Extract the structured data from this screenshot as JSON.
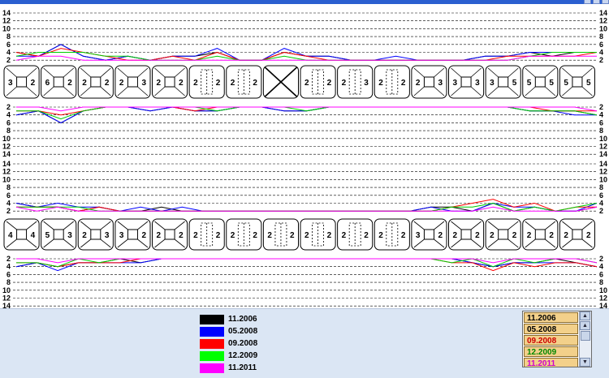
{
  "upper_jaw": {
    "scale_top": [
      "14",
      "12",
      "10",
      "8",
      "6",
      "4",
      "2"
    ],
    "scale_bottom": [
      "2",
      "4",
      "6",
      "8",
      "10",
      "12",
      "14"
    ],
    "teeth": [
      {
        "type": "molar",
        "v": [
          "3",
          "2"
        ]
      },
      {
        "type": "molar",
        "v": [
          "6",
          "2"
        ]
      },
      {
        "type": "molar",
        "v": [
          "2",
          "2"
        ]
      },
      {
        "type": "molar",
        "v": [
          "2",
          "3"
        ]
      },
      {
        "type": "molar",
        "v": [
          "2",
          "2"
        ]
      },
      {
        "type": "premolar",
        "v": [
          "2",
          "2"
        ]
      },
      {
        "type": "premolar",
        "v": [
          "2",
          "2"
        ]
      },
      {
        "type": "missing",
        "v": [
          "",
          ""
        ]
      },
      {
        "type": "premolar",
        "v": [
          "2",
          "2"
        ]
      },
      {
        "type": "premolar",
        "v": [
          "2",
          "3"
        ]
      },
      {
        "type": "premolar",
        "v": [
          "2",
          "2"
        ]
      },
      {
        "type": "molar",
        "v": [
          "2",
          "3"
        ]
      },
      {
        "type": "molar",
        "v": [
          "3",
          "3"
        ]
      },
      {
        "type": "molar",
        "v": [
          "3",
          "5"
        ]
      },
      {
        "type": "molar",
        "v": [
          "5",
          "5"
        ]
      },
      {
        "type": "molar",
        "v": [
          "5",
          "5"
        ]
      }
    ]
  },
  "lower_jaw": {
    "scale_top": [
      "14",
      "12",
      "10",
      "8",
      "6",
      "4",
      "2"
    ],
    "scale_bottom": [
      "2",
      "4",
      "6",
      "8",
      "10",
      "12",
      "14"
    ],
    "teeth": [
      {
        "type": "molar",
        "v": [
          "4",
          "4"
        ]
      },
      {
        "type": "molar",
        "v": [
          "5",
          "3"
        ]
      },
      {
        "type": "molar",
        "v": [
          "2",
          "3"
        ]
      },
      {
        "type": "molar",
        "v": [
          "3",
          "2"
        ]
      },
      {
        "type": "molar",
        "v": [
          "2",
          "2"
        ]
      },
      {
        "type": "premolar",
        "v": [
          "2",
          "2"
        ]
      },
      {
        "type": "premolar",
        "v": [
          "2",
          "2"
        ]
      },
      {
        "type": "premolar",
        "v": [
          "2",
          "2"
        ]
      },
      {
        "type": "premolar",
        "v": [
          "2",
          "2"
        ]
      },
      {
        "type": "premolar",
        "v": [
          "2",
          "2"
        ]
      },
      {
        "type": "premolar",
        "v": [
          "2",
          "2"
        ]
      },
      {
        "type": "molar",
        "v": [
          "3",
          "2"
        ]
      },
      {
        "type": "molar",
        "v": [
          "2",
          "2"
        ]
      },
      {
        "type": "molar",
        "v": [
          "2",
          "2"
        ]
      },
      {
        "type": "molar",
        "v": [
          "2",
          "2"
        ]
      },
      {
        "type": "molar",
        "v": [
          "2",
          "2"
        ]
      }
    ]
  },
  "series_colors": [
    "#000000",
    "#0000ff",
    "#ff0000",
    "#00cc00",
    "#ff00ff"
  ],
  "upper_top_series": [
    [
      4,
      3,
      6,
      3,
      2,
      3,
      2,
      3,
      3,
      4,
      2,
      2,
      4,
      3,
      3,
      2,
      2,
      2,
      2,
      2,
      2,
      3,
      3,
      4,
      3,
      4,
      4
    ],
    [
      3,
      3,
      6,
      3,
      2,
      3,
      2,
      3,
      3,
      5,
      2,
      2,
      5,
      3,
      3,
      2,
      2,
      3,
      2,
      2,
      2,
      3,
      3,
      4,
      4,
      4,
      4
    ],
    [
      4,
      3,
      5,
      4,
      3,
      2,
      2,
      3,
      2,
      4,
      2,
      2,
      4,
      3,
      2,
      2,
      2,
      2,
      2,
      2,
      2,
      2,
      3,
      3,
      3,
      3,
      4
    ],
    [
      3,
      4,
      4,
      4,
      3,
      3,
      2,
      2,
      2,
      3,
      2,
      2,
      3,
      2,
      2,
      2,
      2,
      2,
      2,
      2,
      2,
      2,
      2,
      3,
      4,
      4,
      4
    ],
    [
      2,
      3,
      3,
      2,
      2,
      2,
      2,
      2,
      2,
      2,
      2,
      2,
      2,
      2,
      2,
      2,
      2,
      2,
      2,
      2,
      2,
      2,
      2,
      3,
      3,
      3,
      3
    ]
  ],
  "upper_bottom_series": [
    [
      4,
      3,
      6,
      3,
      2,
      2,
      3,
      2,
      3,
      3,
      2,
      2,
      3,
      3,
      2,
      2,
      2,
      2,
      2,
      2,
      2,
      2,
      2,
      3,
      3,
      3,
      4
    ],
    [
      4,
      3,
      6,
      3,
      2,
      2,
      3,
      2,
      3,
      3,
      2,
      2,
      3,
      3,
      2,
      2,
      2,
      2,
      2,
      2,
      2,
      2,
      2,
      3,
      3,
      4,
      4
    ],
    [
      3,
      3,
      4,
      3,
      2,
      2,
      2,
      2,
      3,
      2,
      2,
      2,
      2,
      2,
      2,
      2,
      2,
      2,
      2,
      2,
      2,
      2,
      2,
      2,
      3,
      3,
      3
    ],
    [
      3,
      3,
      5,
      3,
      2,
      2,
      2,
      2,
      2,
      3,
      2,
      2,
      2,
      3,
      2,
      2,
      2,
      2,
      2,
      2,
      2,
      2,
      2,
      3,
      3,
      3,
      4
    ],
    [
      2,
      2,
      3,
      2,
      2,
      2,
      2,
      2,
      2,
      2,
      2,
      2,
      2,
      2,
      2,
      2,
      2,
      2,
      2,
      2,
      2,
      2,
      2,
      2,
      2,
      2,
      3
    ]
  ],
  "lower_top_series": [
    [
      4,
      3,
      3,
      2,
      3,
      2,
      2,
      3,
      2,
      2,
      2,
      2,
      2,
      2,
      2,
      2,
      2,
      2,
      2,
      2,
      3,
      3,
      2,
      4,
      2,
      3,
      2,
      2,
      3
    ],
    [
      4,
      3,
      4,
      3,
      3,
      2,
      3,
      2,
      3,
      2,
      2,
      2,
      2,
      2,
      2,
      2,
      2,
      2,
      2,
      2,
      3,
      2,
      2,
      4,
      3,
      3,
      2,
      2,
      4
    ],
    [
      3,
      3,
      3,
      2,
      3,
      2,
      2,
      2,
      2,
      2,
      2,
      2,
      2,
      2,
      2,
      2,
      2,
      2,
      2,
      2,
      2,
      3,
      4,
      5,
      3,
      4,
      2,
      3,
      3
    ],
    [
      3,
      3,
      3,
      3,
      2,
      2,
      2,
      2,
      2,
      2,
      2,
      2,
      2,
      2,
      2,
      2,
      2,
      2,
      2,
      2,
      2,
      3,
      3,
      4,
      2,
      3,
      2,
      3,
      4
    ],
    [
      3,
      2,
      3,
      2,
      2,
      2,
      2,
      2,
      2,
      2,
      2,
      2,
      2,
      2,
      2,
      2,
      2,
      2,
      2,
      2,
      2,
      2,
      2,
      3,
      2,
      2,
      2,
      2,
      3
    ]
  ],
  "lower_bottom_series": [
    [
      4,
      3,
      4,
      3,
      3,
      2,
      3,
      2,
      2,
      2,
      2,
      2,
      2,
      2,
      2,
      2,
      2,
      2,
      2,
      2,
      2,
      2,
      3,
      4,
      3,
      3,
      2,
      3,
      4
    ],
    [
      4,
      3,
      5,
      3,
      3,
      3,
      3,
      2,
      2,
      2,
      2,
      2,
      2,
      2,
      2,
      2,
      2,
      2,
      2,
      2,
      2,
      2,
      3,
      4,
      3,
      3,
      3,
      3,
      4
    ],
    [
      3,
      3,
      4,
      3,
      3,
      3,
      2,
      2,
      2,
      2,
      2,
      2,
      2,
      2,
      2,
      2,
      2,
      2,
      2,
      2,
      2,
      3,
      3,
      5,
      3,
      4,
      3,
      3,
      4
    ],
    [
      3,
      3,
      4,
      2,
      3,
      2,
      2,
      2,
      2,
      2,
      2,
      2,
      2,
      2,
      2,
      2,
      2,
      2,
      2,
      2,
      2,
      3,
      2,
      4,
      2,
      3,
      2,
      2,
      3
    ],
    [
      2,
      2,
      3,
      2,
      2,
      2,
      2,
      2,
      2,
      2,
      2,
      2,
      2,
      2,
      2,
      2,
      2,
      2,
      2,
      2,
      2,
      2,
      2,
      3,
      2,
      2,
      2,
      2,
      3
    ]
  ],
  "legend": [
    {
      "label": "11.2006",
      "color": "#000000"
    },
    {
      "label": "05.2008",
      "color": "#0000ff"
    },
    {
      "label": "09.2008",
      "color": "#ff0000"
    },
    {
      "label": "12.2009",
      "color": "#00ff00"
    },
    {
      "label": "11.2011",
      "color": "#ff00ff"
    }
  ],
  "date_list": [
    {
      "label": "11.2006",
      "color": "#000000"
    },
    {
      "label": "05.2008",
      "color": "#000000"
    },
    {
      "label": "09.2008",
      "color": "#cc0000"
    },
    {
      "label": "12.2009",
      "color": "#008800"
    },
    {
      "label": "11.2011",
      "color": "#cc00cc"
    }
  ],
  "scrollbar": {
    "up": "▲",
    "down": "▼"
  }
}
